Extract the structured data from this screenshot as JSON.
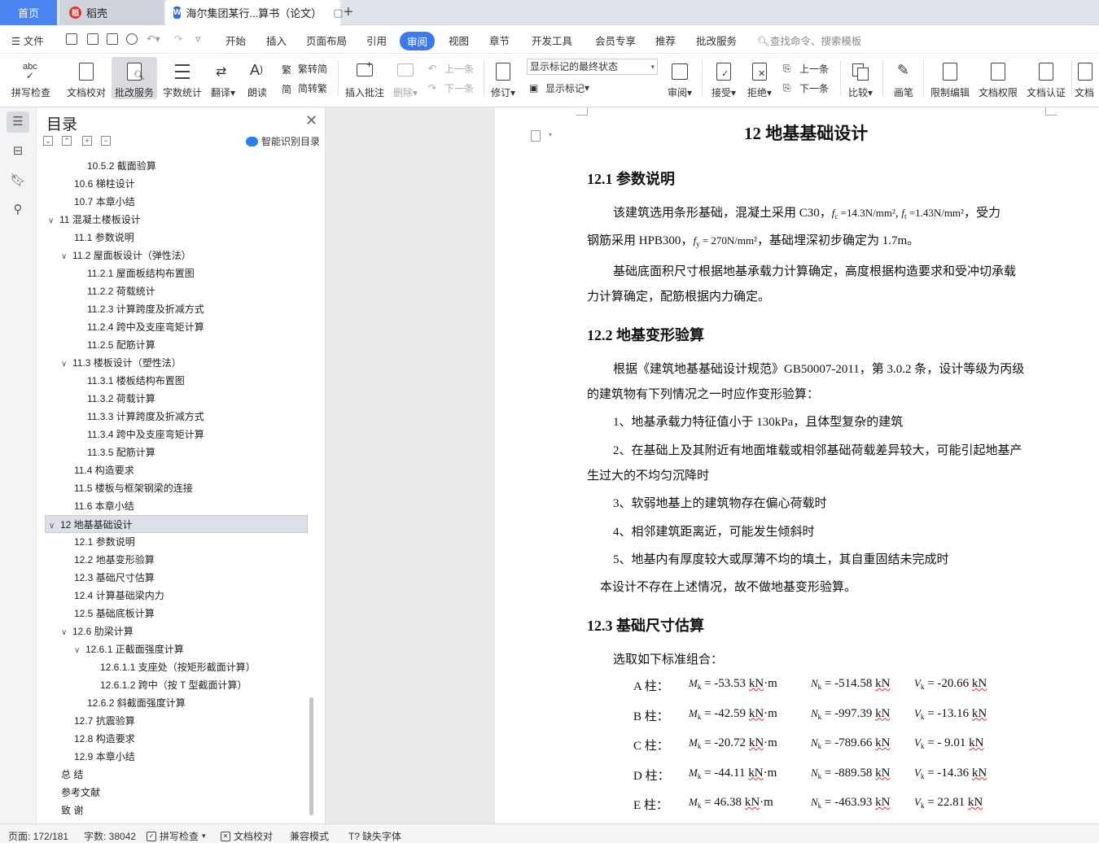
{
  "tabs": {
    "home": "首页",
    "daoke": "稻壳",
    "doc": "海尔集团某行...算书（论文）"
  },
  "menu": {
    "file": "文件",
    "items": [
      "开始",
      "插入",
      "页面布局",
      "引用",
      "审阅",
      "视图",
      "章节",
      "开发工具",
      "会员专享",
      "推荐",
      "批改服务"
    ],
    "active": "审阅",
    "search": "查找命令、搜索模板"
  },
  "ribbon": {
    "spell": "拼写检查",
    "proof": "文档校对",
    "review_service": "批改服务",
    "wordcount": "字数统计",
    "translate": "翻译",
    "read": "朗读",
    "trad": "繁转简",
    "simp": "简转繁",
    "insert_comment": "插入批注",
    "delete": "删除",
    "prev": "上一条",
    "next": "下一条",
    "revise": "修订",
    "show_dropdown": "显示标记的最终状态",
    "show_marks": "显示标记",
    "review": "审阅",
    "accept": "接受",
    "reject": "拒绝",
    "prev2": "上一条",
    "next2": "下一条",
    "compare": "比较",
    "pen": "画笔",
    "restrict": "限制编辑",
    "perm": "文档权限",
    "auth": "文档认证",
    "cut": "文档"
  },
  "toc": {
    "title": "目录",
    "smart": "智能识别目录",
    "items": [
      {
        "t": "10.5.2 截面验算",
        "lvl": 3
      },
      {
        "t": "10.6 梯柱设计",
        "lvl": 2
      },
      {
        "t": "10.7  本章小结",
        "lvl": 2
      },
      {
        "t": "11  混凝土楼板设计",
        "lvl": 1,
        "open": true
      },
      {
        "t": "11.1 参数说明",
        "lvl": 2
      },
      {
        "t": "11.2  屋面板设计（弹性法）",
        "lvl": 2,
        "open": true
      },
      {
        "t": "11.2.1 屋面板结构布置图",
        "lvl": 3
      },
      {
        "t": "11.2.2 荷载统计",
        "lvl": 3
      },
      {
        "t": "11.2.3  计算跨度及折减方式",
        "lvl": 3
      },
      {
        "t": "11.2.4 跨中及支座弯矩计算",
        "lvl": 3
      },
      {
        "t": "11.2.5 配筋计算",
        "lvl": 3
      },
      {
        "t": "11.3  楼板设计（塑性法）",
        "lvl": 2,
        "open": true
      },
      {
        "t": "11.3.1 楼板结构布置图",
        "lvl": 3
      },
      {
        "t": "11.3.2 荷载计算",
        "lvl": 3
      },
      {
        "t": "11.3.3  计算跨度及折减方式",
        "lvl": 3
      },
      {
        "t": "11.3.4 跨中及支座弯矩计算",
        "lvl": 3
      },
      {
        "t": "11.3.5 配筋计算",
        "lvl": 3
      },
      {
        "t": "11.4  构造要求",
        "lvl": 2
      },
      {
        "t": "11.5 楼板与框架钢梁的连接",
        "lvl": 2
      },
      {
        "t": "11.6  本章小结",
        "lvl": 2
      },
      {
        "t": "12  地基基础设计",
        "lvl": 1,
        "open": true,
        "sel": true
      },
      {
        "t": "12.1 参数说明",
        "lvl": 2
      },
      {
        "t": "12.2 地基变形验算",
        "lvl": 2
      },
      {
        "t": "12.3 基础尺寸估算",
        "lvl": 2
      },
      {
        "t": "12.4 计算基础梁内力",
        "lvl": 2
      },
      {
        "t": "12.5 基础底板计算",
        "lvl": 2
      },
      {
        "t": "12.6 肋梁计算",
        "lvl": 2,
        "open": true
      },
      {
        "t": "12.6.1 正截面强度计算",
        "lvl": 3,
        "open": true
      },
      {
        "t": "12.6.1.1 支座处（按矩形截面计算）",
        "lvl": 4
      },
      {
        "t": "12.6.1.2 跨中（按 T 型截面计算）",
        "lvl": 4
      },
      {
        "t": "12.6.2 斜截面强度计算",
        "lvl": 3
      },
      {
        "t": "12.7 抗震验算",
        "lvl": 2
      },
      {
        "t": "12.8 构造要求",
        "lvl": 2
      },
      {
        "t": "12.9  本章小结",
        "lvl": 2
      },
      {
        "t": "总    结",
        "lvl": 1
      },
      {
        "t": "参考文献",
        "lvl": 1
      },
      {
        "t": "致    谢",
        "lvl": 1
      }
    ]
  },
  "doc": {
    "chapter": "12  地基基础设计",
    "s1": "12.1 参数说明",
    "p1a_pre": "该建筑选用条形基础，混凝土采用  C30，",
    "p1a_fc": "f",
    "p1a_fc_sub": "c",
    "p1a_fc_val": " =14.3N/mm²",
    "p1a_ft": "f",
    "p1a_ft_sub": "t",
    "p1a_ft_val": " =1.43N/mm²",
    "p1a_post": "，受力",
    "p1b_pre": "钢筋采用  HPB300，",
    "p1b_fy": "f",
    "p1b_fy_sub": "y",
    "p1b_fy_val": " = 270N/mm²",
    "p1b_post": "，基础埋深初步确定为  1.7m。",
    "p2a": "基础底面积尺寸根据地基承载力计算确定，高度根据构造要求和受冲切承载",
    "p2b": "力计算确定，配筋根据内力确定。",
    "s2": "12.2 地基变形验算",
    "p3a": "根据《建筑地基基础设计规范》GB50007-2011，第  3.0.2  条，设计等级为丙级",
    "p3b": "的建筑物有下列情况之一时应作变形验算：",
    "l1": "1、地基承载力特征值小于  130kPa，且体型复杂的建筑",
    "l2a": "2、在基础上及其附近有地面堆载或相邻基础荷载差异较大，可能引起地基产",
    "l2b": "生过大的不均匀沉降时",
    "l3": "3、软弱地基上的建筑物存在偏心荷载时",
    "l4": "4、相邻建筑距离近，可能发生倾斜时",
    "l5": "5、地基内有厚度较大或厚薄不均的填土，其自重固结未完成时",
    "p4": "本设计不存在上述情况，故不做地基变形验算。",
    "s3": "12.3 基础尺寸估算",
    "p5": "选取如下标准组合：",
    "cols": [
      {
        "lab": "A 柱：",
        "m": "= -53.53",
        "n": "= -514.58",
        "v": "= -20.66"
      },
      {
        "lab": "B 柱：",
        "m": "= -42.59",
        "n": "= -997.39",
        "v": "= -13.16"
      },
      {
        "lab": "C 柱：",
        "m": "= -20.72",
        "n": "= -789.66",
        "v": "= - 9.01"
      },
      {
        "lab": "D 柱：",
        "m": "= -44.11",
        "n": "= -889.58",
        "v": "= -14.36"
      },
      {
        "lab": "E 柱：",
        "m": "=    46.38",
        "n": "= -463.93",
        "v": "=    22.81"
      }
    ],
    "sym_m": "M",
    "sym_n": "N",
    "sym_v": "V",
    "sym_sub": "k",
    "unit_kn": "kN",
    "unit_m": "·m"
  },
  "status": {
    "page": "页面: 172/181",
    "words": "字数: 38042",
    "spell": "拼写检查",
    "proof": "文档校对",
    "compat": "兼容模式",
    "font": "缺失字体"
  },
  "colors": {
    "accent": "#3c78f0",
    "home_tab": "#4a83f2",
    "squiggle": "#e03030"
  }
}
